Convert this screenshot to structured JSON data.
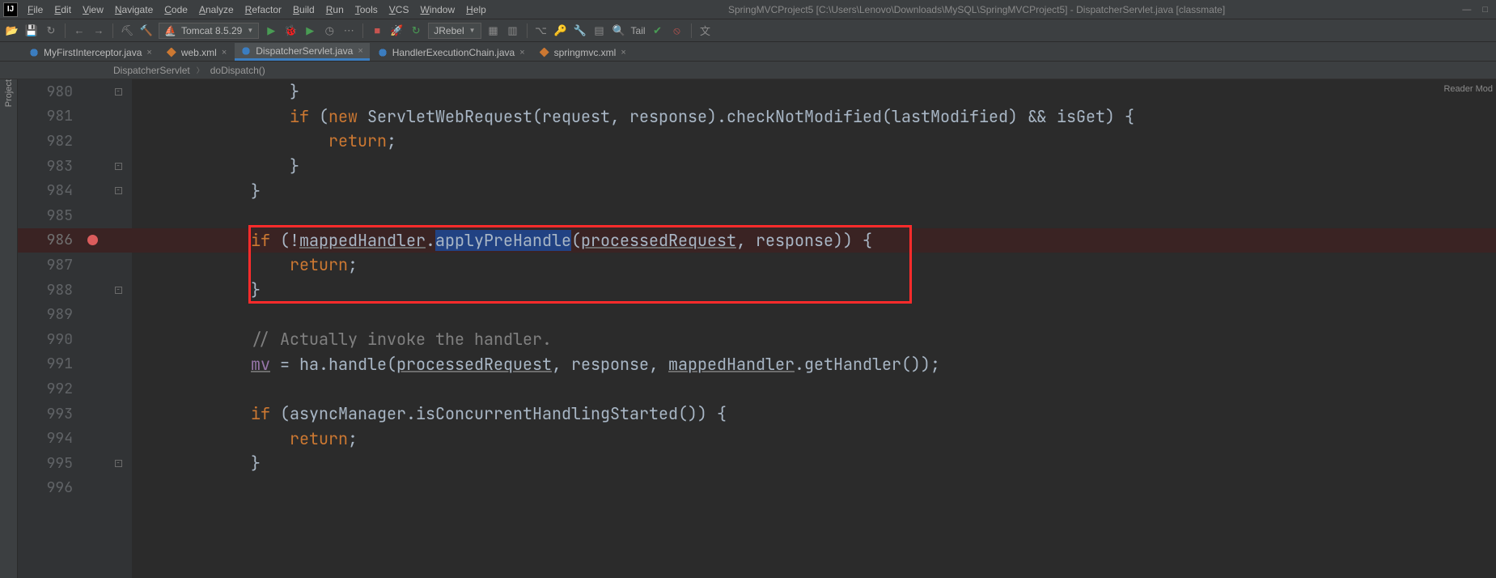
{
  "app_icon_letter": "IJ",
  "window_title": "SpringMVCProject5 [C:\\Users\\Lenovo\\Downloads\\MySQL\\SpringMVCProject5] - DispatcherServlet.java [classmate]",
  "window_min": "—",
  "window_max": "□",
  "menu": [
    "File",
    "Edit",
    "View",
    "Navigate",
    "Code",
    "Analyze",
    "Refactor",
    "Build",
    "Run",
    "Tools",
    "VCS",
    "Window",
    "Help"
  ],
  "toolbar": {
    "run_config": "Tomcat 8.5.29",
    "plugin_label": "JRebel",
    "tail_label": "Tail"
  },
  "tabs": [
    {
      "label": "MyFirstInterceptor.java",
      "icon": "class",
      "active": false
    },
    {
      "label": "web.xml",
      "icon": "xml",
      "active": false
    },
    {
      "label": "DispatcherServlet.java",
      "icon": "class",
      "active": true
    },
    {
      "label": "HandlerExecutionChain.java",
      "icon": "class",
      "active": false
    },
    {
      "label": "springmvc.xml",
      "icon": "xml",
      "active": false
    }
  ],
  "breadcrumb": [
    "DispatcherServlet",
    "doDispatch()"
  ],
  "left_tool_label": "Project",
  "reader_mode_label": "Reader Mod",
  "first_line_number": 980,
  "lines": [
    {
      "n": 980,
      "fold": "up",
      "html": "                }"
    },
    {
      "n": 981,
      "fold": "line",
      "html": "                <span class='kw'>if</span> (<span class='kw'>new</span> ServletWebRequest(request, response).checkNotModified(lastModified) && isGet) {"
    },
    {
      "n": 982,
      "fold": "line",
      "html": "                    <span class='kw'>return</span>;"
    },
    {
      "n": 983,
      "fold": "up",
      "html": "                }"
    },
    {
      "n": 984,
      "fold": "up",
      "html": "            }"
    },
    {
      "n": 985,
      "fold": "",
      "html": ""
    },
    {
      "n": 986,
      "fold": "line",
      "bp": true,
      "html": "            <span class='kw'>if</span> (!<span class='ul'>mappedHandler</span>.<span class='hl'>applyPreHandle</span>(<span class='ul'>processedRequest</span>, response)) {"
    },
    {
      "n": 987,
      "fold": "line",
      "html": "                <span class='kw'>return</span>;"
    },
    {
      "n": 988,
      "fold": "up",
      "html": "            }"
    },
    {
      "n": 989,
      "fold": "",
      "html": ""
    },
    {
      "n": 990,
      "fold": "",
      "html": "            <span class='cmt'>// Actually invoke the handler.</span>"
    },
    {
      "n": 991,
      "fold": "",
      "html": "            <span class='ul var'>mv</span> = ha.handle(<span class='ul'>processedRequest</span>, response, <span class='ul'>mappedHandler</span>.getHandler());"
    },
    {
      "n": 992,
      "fold": "",
      "html": ""
    },
    {
      "n": 993,
      "fold": "line",
      "html": "            <span class='kw'>if</span> (asyncManager.isConcurrentHandlingStarted()) {"
    },
    {
      "n": 994,
      "fold": "line",
      "html": "                <span class='kw'>return</span>;"
    },
    {
      "n": 995,
      "fold": "up",
      "html": "            }"
    },
    {
      "n": 996,
      "fold": "",
      "html": ""
    }
  ],
  "highlight_box": {
    "from_line": 986,
    "to_line": 988
  }
}
